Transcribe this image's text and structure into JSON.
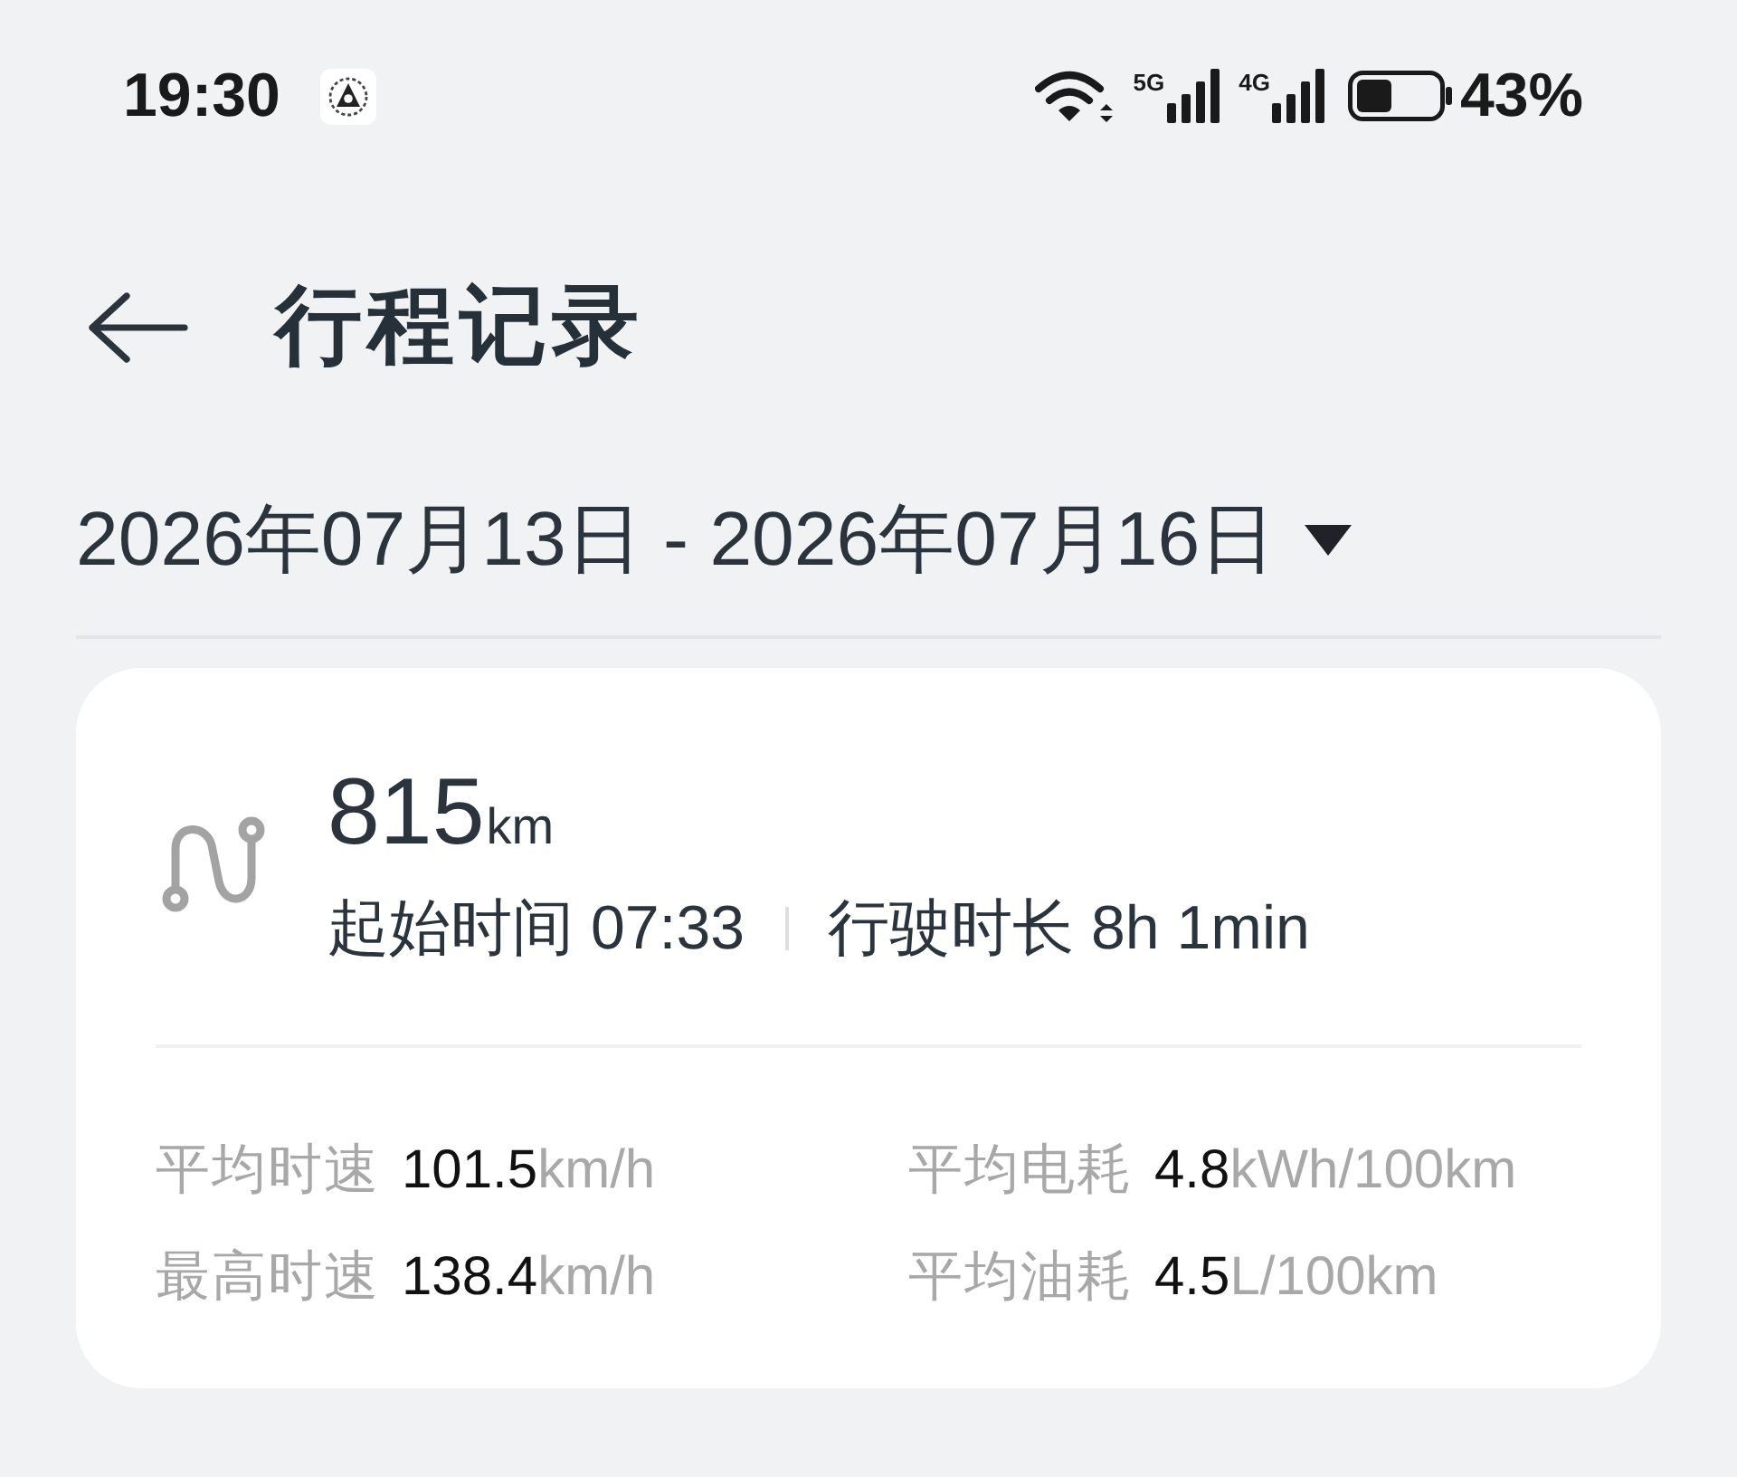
{
  "status_bar": {
    "time": "19:30",
    "networks": [
      {
        "label": "5G"
      },
      {
        "label": "4G"
      }
    ],
    "battery": "43%"
  },
  "header": {
    "title": "行程记录"
  },
  "date_range": {
    "text": "2026年07月13日 - 2026年07月16日"
  },
  "trip": {
    "distance": {
      "value": "815",
      "unit": "km"
    },
    "details": [
      "起始时间 07:33",
      "行驶时长 8h 1min"
    ],
    "stats": [
      {
        "label": "平均时速",
        "value": "101.5",
        "unit": "km/h"
      },
      {
        "label": "平均电耗",
        "value": "4.8",
        "unit": "kWh/100km"
      },
      {
        "label": "最高时速",
        "value": "138.4",
        "unit": "km/h"
      },
      {
        "label": "平均油耗",
        "value": "4.5",
        "unit": "L/100km"
      }
    ]
  }
}
